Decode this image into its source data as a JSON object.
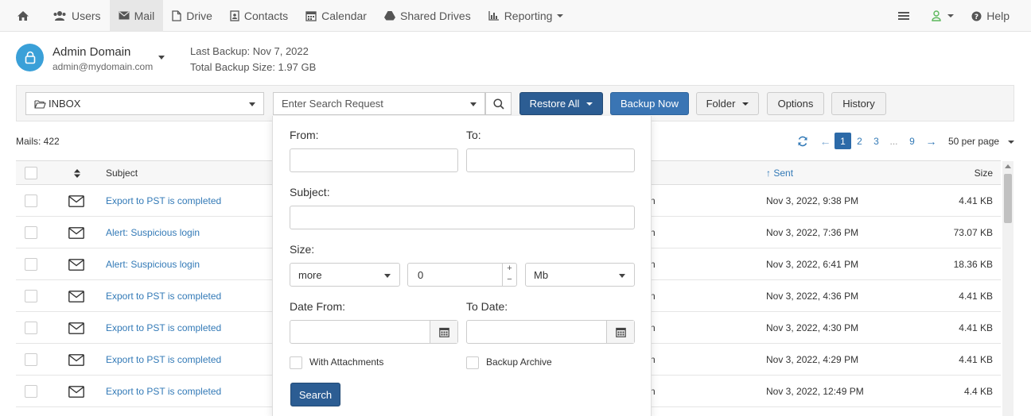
{
  "nav": {
    "items": [
      {
        "label": ""
      },
      {
        "label": "Users"
      },
      {
        "label": "Mail"
      },
      {
        "label": "Drive"
      },
      {
        "label": "Contacts"
      },
      {
        "label": "Calendar"
      },
      {
        "label": "Shared Drives"
      },
      {
        "label": "Reporting"
      }
    ],
    "help_label": "Help"
  },
  "account": {
    "name": "Admin Domain",
    "email": "admin@mydomain.com",
    "last_backup": "Last Backup: Nov 7, 2022",
    "total_size": "Total Backup Size: 1.97 GB"
  },
  "toolbar": {
    "folder": "INBOX",
    "search_placeholder": "Enter Search Request",
    "restore_all": "Restore All",
    "backup_now": "Backup Now",
    "folder_btn": "Folder",
    "options": "Options",
    "history": "History"
  },
  "list": {
    "count": "Mails: 422",
    "pages": [
      "1",
      "2",
      "3",
      "...",
      "9"
    ],
    "per_page": "50 per page"
  },
  "table": {
    "headers": {
      "subject": "Subject",
      "sent": "Sent",
      "size": "Size"
    },
    "rows": [
      {
        "subject": "Export to PST is completed",
        "from_tail": "n",
        "sent": "Nov 3, 2022, 9:38 PM",
        "size": "4.41 KB"
      },
      {
        "subject": "Alert: Suspicious login",
        "from_tail": "n",
        "sent": "Nov 3, 2022, 7:36 PM",
        "size": "73.07 KB"
      },
      {
        "subject": "Alert: Suspicious login",
        "from_tail": "n",
        "sent": "Nov 3, 2022, 6:41 PM",
        "size": "18.36 KB"
      },
      {
        "subject": "Export to PST is completed",
        "from_tail": "n",
        "sent": "Nov 3, 2022, 4:36 PM",
        "size": "4.41 KB"
      },
      {
        "subject": "Export to PST is completed",
        "from_tail": "n",
        "sent": "Nov 3, 2022, 4:30 PM",
        "size": "4.41 KB"
      },
      {
        "subject": "Export to PST is completed",
        "from_tail": "n",
        "sent": "Nov 3, 2022, 4:29 PM",
        "size": "4.41 KB"
      },
      {
        "subject": "Export to PST is completed",
        "from_tail": "n",
        "sent": "Nov 3, 2022, 12:49 PM",
        "size": "4.4 KB"
      }
    ]
  },
  "search_panel": {
    "from_label": "From:",
    "to_label": "To:",
    "subject_label": "Subject:",
    "size_label": "Size:",
    "size_op": "more",
    "size_value": "0",
    "size_unit": "Mb",
    "date_from_label": "Date From:",
    "to_date_label": "To Date:",
    "with_attachments": "With Attachments",
    "backup_archive": "Backup Archive",
    "search_btn": "Search"
  },
  "colors": {
    "accent_dark": "#2c5d93",
    "accent": "#3a75b4",
    "link": "#337ab7",
    "avatar": "#3aa0d8",
    "user_icon_green": "#5cb85c"
  }
}
